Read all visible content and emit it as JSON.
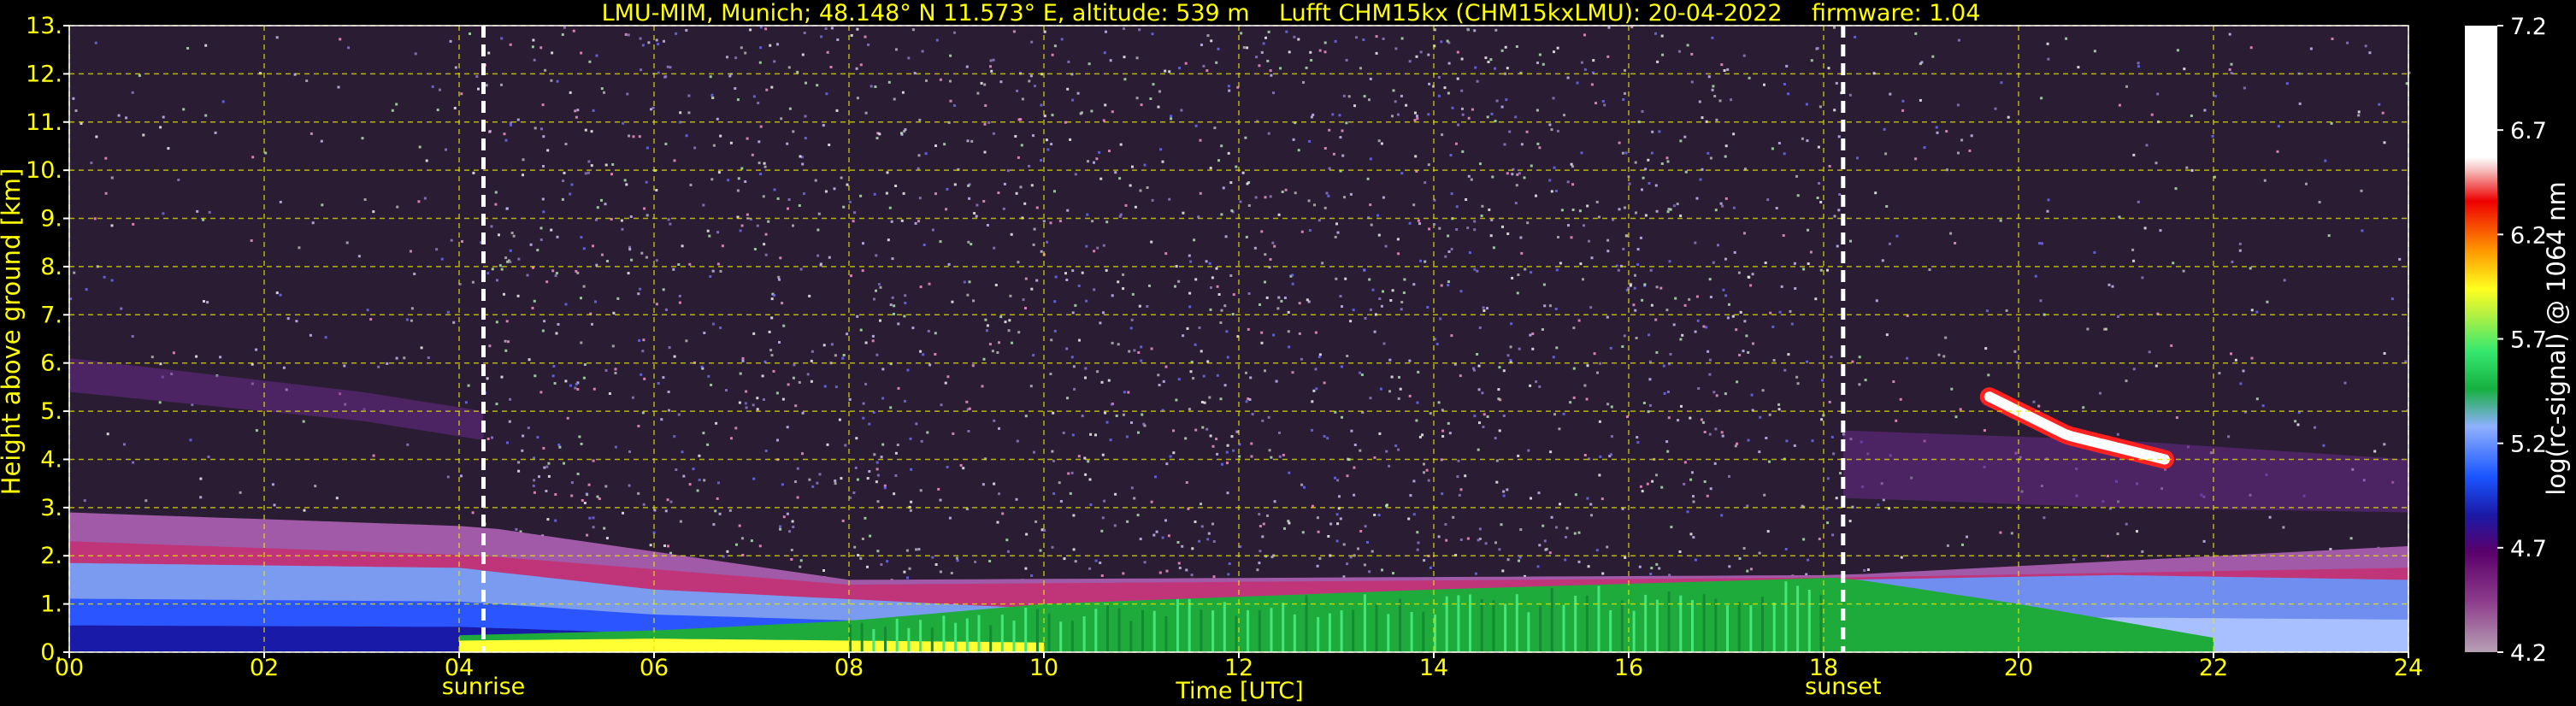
{
  "chart_data": {
    "type": "heatmap",
    "title": "LMU-MIM, Munich; 48.148° N 11.573° E, altitude: 539 m    Lufft CHM15kx (CHM15kxLMU): 20-04-2022    firmware: 1.04",
    "xlabel": "Time [UTC]",
    "ylabel": "Height above ground [km]",
    "xlim": [
      0,
      24
    ],
    "ylim": [
      0,
      13
    ],
    "x_ticks": [
      "00",
      "02",
      "04",
      "06",
      "08",
      "10",
      "12",
      "14",
      "16",
      "18",
      "20",
      "22",
      "24"
    ],
    "y_ticks": [
      "0.",
      "1.",
      "2.",
      "3.",
      "4.",
      "5.",
      "6.",
      "7.",
      "8.",
      "9.",
      "10.",
      "11.",
      "12.",
      "13."
    ],
    "grid": true,
    "markers": [
      {
        "label": "sunrise",
        "time": 4.25
      },
      {
        "label": "sunset",
        "time": 18.2
      }
    ],
    "colorbar": {
      "label": "log(rc-signal) @ 1064 nm",
      "range": [
        4.2,
        7.2
      ],
      "ticks": [
        "4.2",
        "4.7",
        "5.2",
        "5.7",
        "6.2",
        "6.7",
        "7.2"
      ]
    },
    "layers": [
      {
        "name": "boundary-layer-morning",
        "t": [
          0,
          4,
          6,
          10
        ],
        "top_km": [
          1.85,
          1.75,
          1.3,
          0.9
        ]
      },
      {
        "name": "mixed-layer-afternoon",
        "t": [
          10,
          14,
          18.2
        ],
        "top_km": [
          1.0,
          1.3,
          1.55
        ]
      },
      {
        "name": "evening-aerosol",
        "t": [
          18.2,
          21,
          24
        ],
        "top_km": [
          1.5,
          1.6,
          1.5
        ]
      },
      {
        "name": "cloud",
        "t": [
          19.7,
          20.5,
          21.5
        ],
        "height_km": [
          5.3,
          4.5,
          4.0
        ]
      }
    ]
  }
}
